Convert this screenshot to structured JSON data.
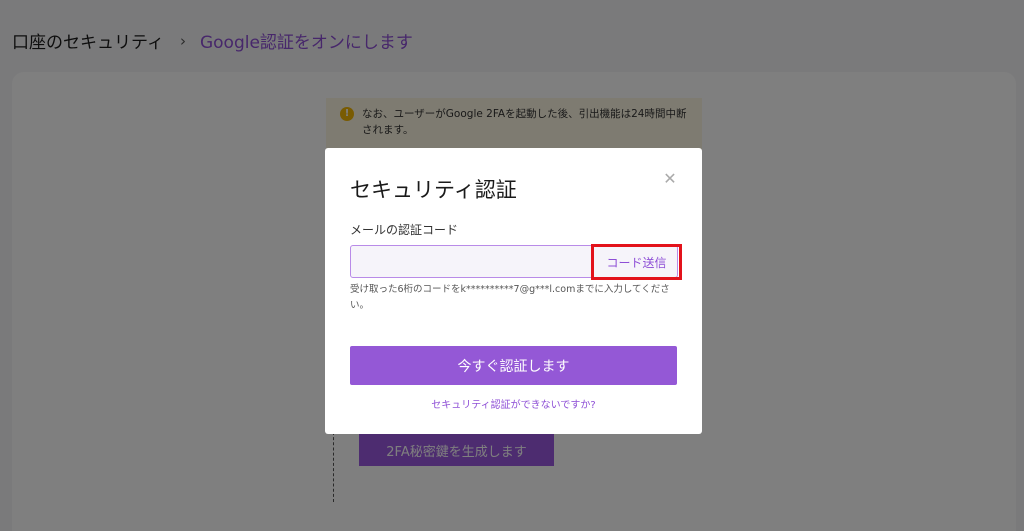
{
  "breadcrumb": {
    "root": "口座のセキュリティ",
    "separator": "›",
    "current": "Google認証をオンにします"
  },
  "background": {
    "notice_icon": "!",
    "notice_text": "なお、ユーザーがGoogle 2FAを起動した後、引出機能は24時間中断されます。",
    "generate_button": "2FA秘密鍵を生成します"
  },
  "modal": {
    "title": "セキュリティ認証",
    "close_icon": "✕",
    "field_label": "メールの認証コード",
    "code_value": "",
    "code_placeholder": "",
    "send_code": "コード送信",
    "hint": "受け取った6桁のコードをk**********7@g***l.comまでに入力してください。",
    "submit": "今すぐ認証します",
    "help_link": "セキュリティ認証ができないですか?"
  },
  "colors": {
    "accent": "#9458d6",
    "highlight_border": "#e3121b",
    "notice_bg": "#fdf7e3"
  }
}
